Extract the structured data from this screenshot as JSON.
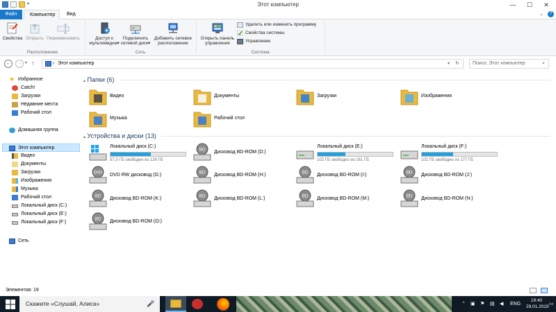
{
  "window": {
    "title": "Этот компьютер",
    "minimize": "—",
    "maximize": "☐",
    "close": "✕"
  },
  "tabs": {
    "file": "Файл",
    "computer": "Компьютер",
    "view": "Вид"
  },
  "ribbon": {
    "location": {
      "label": "Расположение",
      "properties": "Свойства",
      "open": "Открыть",
      "rename": "Переименовать"
    },
    "network": {
      "label": "Сеть",
      "media_access_1": "Доступ к",
      "media_access_2": "мультимедиа",
      "map_drive_1": "Подключить",
      "map_drive_2": "сетевой диск",
      "add_location_1": "Добавить сетевое",
      "add_location_2": "расположение"
    },
    "system": {
      "label": "Система",
      "control_panel_1": "Открыть панель",
      "control_panel_2": "управления",
      "uninstall": "Удалить или изменить программу",
      "sys_props": "Свойства системы",
      "manage": "Управление"
    }
  },
  "address": {
    "path": "Этот компьютер",
    "separator": "›",
    "search_placeholder": "Поиск: Этот компьютер"
  },
  "nav": {
    "favorites": "Избранное",
    "fav_items": [
      "Catch!",
      "Загрузки",
      "Недавние места",
      "Рабочий стол"
    ],
    "homegroup": "Домашняя группа",
    "this_pc": "Этот компьютер",
    "pc_items": [
      "Видео",
      "Документы",
      "Загрузки",
      "Изображения",
      "Музыка",
      "Рабочий стол",
      "Локальный диск (C:)",
      "Локальный диск (E:)",
      "Локальный диск (F:)"
    ],
    "network": "Сеть"
  },
  "folders": {
    "header": "Папки (6)",
    "items": [
      "Видео",
      "Документы",
      "Загрузки",
      "Изображения",
      "Музыка",
      "Рабочий стол"
    ]
  },
  "devices": {
    "header": "Устройства и диски (13)",
    "drives": [
      {
        "name": "Локальный диск (C:)",
        "free": "57,5 ГБ свободно из 126 ГБ",
        "used_fraction": 0.54
      },
      {
        "name": "Дисковод BD-ROM (D:)"
      },
      {
        "name": "Локальный диск (E:)",
        "free": "102 ГБ свободно из 161 ГБ",
        "used_fraction": 0.37
      },
      {
        "name": "Локальный диск (F:)",
        "free": "102 ГБ свободно из 177 ГБ",
        "used_fraction": 0.42
      },
      {
        "name": "DVD RW дисковод (G:)"
      },
      {
        "name": "Дисковод BD-ROM (H:)"
      },
      {
        "name": "Дисковод BD-ROM (I:)"
      },
      {
        "name": "Дисковод BD-ROM (J:)"
      },
      {
        "name": "Дисковод BD-ROM (K:)"
      },
      {
        "name": "Дисковод BD-ROM (L:)"
      },
      {
        "name": "Дисковод BD-ROM (M:)"
      },
      {
        "name": "Дисковод BD-ROM (N:)"
      },
      {
        "name": "Дисковод BD-ROM (O:)"
      }
    ]
  },
  "status": {
    "items": "Элементов: 19"
  },
  "taskbar": {
    "search": "Скажите «Слушай, Алиса»",
    "lang": "ENG",
    "time": "19:40",
    "date": "29.01.2019"
  },
  "colors": {
    "accent": "#1979ca",
    "folder": "#e8b93e",
    "bar": "#26a0da",
    "taskbar": "#101a25"
  }
}
